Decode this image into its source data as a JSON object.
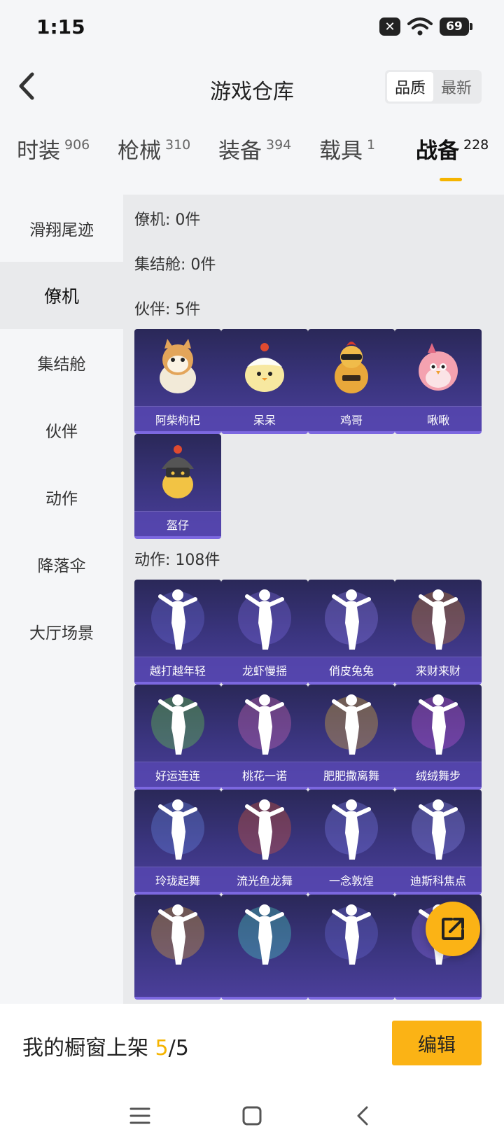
{
  "status_bar": {
    "time": "1:15",
    "battery": "69",
    "icons": [
      "close-icon",
      "wifi-icon",
      "battery-icon"
    ]
  },
  "header": {
    "title": "游戏仓库",
    "back_icon": "chevron-left-icon",
    "sort_options": [
      "品质",
      "最新"
    ],
    "sort_active": "品质"
  },
  "tabs": [
    {
      "label": "时装",
      "count": "906"
    },
    {
      "label": "枪械",
      "count": "310"
    },
    {
      "label": "装备",
      "count": "394"
    },
    {
      "label": "载具",
      "count": "1"
    },
    {
      "label": "战备",
      "count": "228"
    }
  ],
  "active_tab": "战备",
  "sidebar": {
    "items": [
      "滑翔尾迹",
      "僚机",
      "集结舱",
      "伙伴",
      "动作",
      "降落伞",
      "大厅场景"
    ],
    "active": "僚机"
  },
  "sections": {
    "wingman": "僚机: 0件",
    "rally_pod": "集结舱: 0件",
    "partner": "伙伴: 5件",
    "emote": "动作: 108件"
  },
  "partners": [
    "阿柴枸杞",
    "呆呆",
    "鸡哥",
    "啾啾",
    "盔仔"
  ],
  "emotes": [
    "越打越年轻",
    "龙虾慢摇",
    "俏皮兔兔",
    "来财来财",
    "好运连连",
    "桃花一诺",
    "肥肥撒离舞",
    "绒绒舞步",
    "玲珑起舞",
    "流光鱼龙舞",
    "一念敦煌",
    "迪斯科焦点",
    "",
    "",
    "",
    ""
  ],
  "bottom": {
    "showcase_label": "我的橱窗上架 ",
    "showcase_current": "5",
    "showcase_total": "/5",
    "edit_label": "编辑"
  },
  "colors": {
    "accent": "#fbb315",
    "card_bg": "#3b3580",
    "card_border": "#7c68e0"
  }
}
